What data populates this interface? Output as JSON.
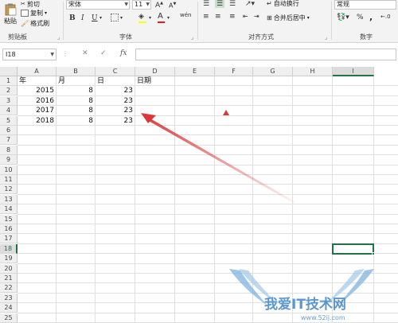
{
  "ribbon": {
    "clipboard": {
      "paste_label": "粘贴",
      "cut_label": "剪切",
      "copy_label": "复制",
      "format_painter_label": "格式刷",
      "group_label": "剪贴板"
    },
    "font": {
      "font_name": "宋体",
      "font_size": "11",
      "bold": "B",
      "italic": "I",
      "underline": "U",
      "group_label": "字体"
    },
    "alignment": {
      "wrap_text_label": "自动换行",
      "merge_center_label": "合并后居中",
      "group_label": "对齐方式"
    },
    "number": {
      "format": "常规",
      "percent": "%",
      "comma": ",",
      "group_label": "数字"
    }
  },
  "formula_bar": {
    "name_box": "I18",
    "cancel": "✕",
    "confirm": "✓",
    "fx": "fx",
    "formula": ""
  },
  "sheet": {
    "columns": [
      "A",
      "B",
      "C",
      "D",
      "E",
      "F",
      "G",
      "H",
      "I"
    ],
    "active_column": "I",
    "rows": [
      "1",
      "2",
      "3",
      "4",
      "5",
      "6",
      "7",
      "8",
      "9",
      "10",
      "11",
      "12",
      "13",
      "14",
      "15",
      "16",
      "17",
      "18",
      "19",
      "20",
      "21",
      "22",
      "23",
      "24",
      "25"
    ],
    "active_row": "18",
    "header_row": {
      "A": "年",
      "B": "月",
      "C": "日",
      "D": "日期"
    },
    "data_rows": [
      {
        "A": "2015",
        "B": "8",
        "C": "23"
      },
      {
        "A": "2016",
        "B": "8",
        "C": "23"
      },
      {
        "A": "2017",
        "B": "8",
        "C": "23"
      },
      {
        "A": "2018",
        "B": "8",
        "C": "23"
      }
    ]
  },
  "watermark": {
    "text": "我爱IT技术网",
    "url": "www.52ij.com"
  },
  "colors": {
    "accent_green": "#217346",
    "annotation_red": "#d9393b",
    "watermark_blue": "#3f86c8"
  }
}
